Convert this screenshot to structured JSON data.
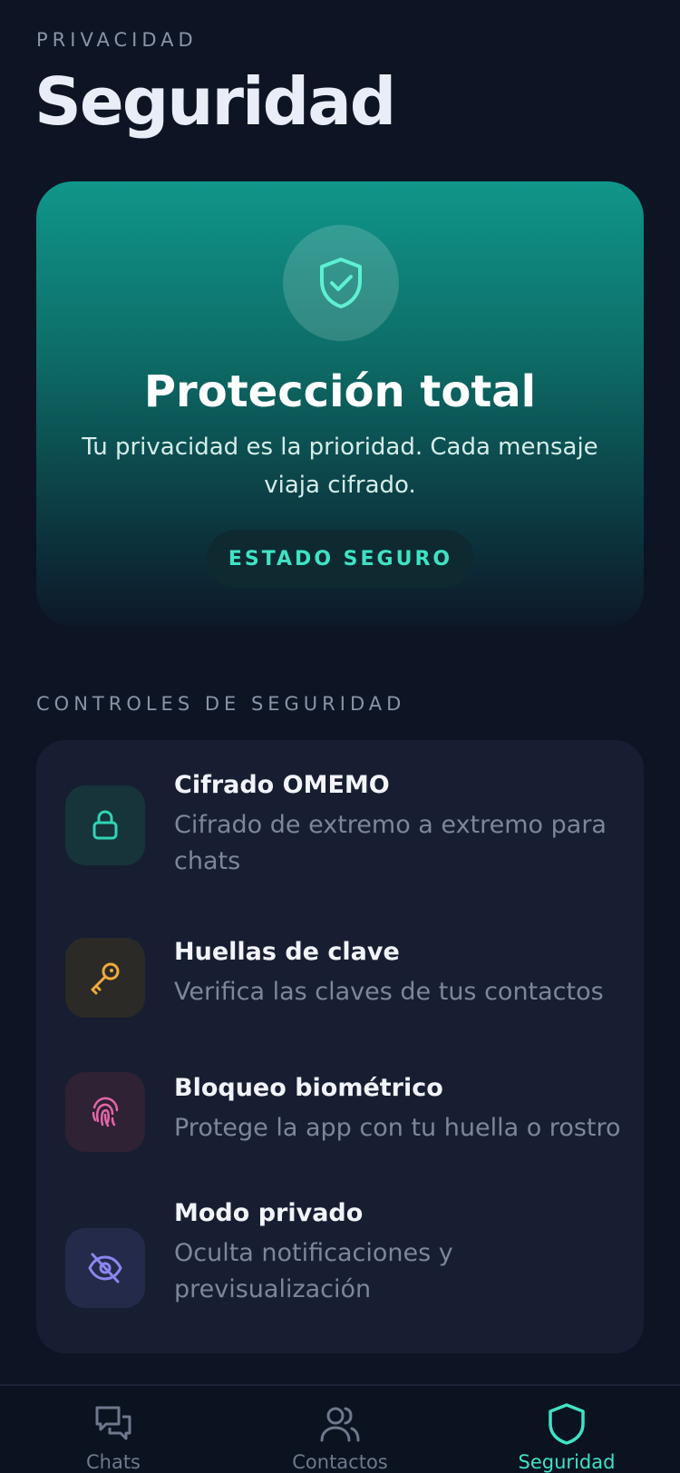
{
  "header": {
    "eyebrow": "PRIVACIDAD",
    "title": "Seguridad"
  },
  "hero": {
    "icon": "shield-check-icon",
    "title": "Protección total",
    "subtitle": "Tu privacidad es la prioridad. Cada mensaje viaja cifrado.",
    "status": "ESTADO SEGURO"
  },
  "section": {
    "label": "CONTROLES DE SEGURIDAD"
  },
  "controls": [
    {
      "icon": "lock-icon",
      "title": "Cifrado OMEMO",
      "description": "Cifrado de extremo a extremo para chats",
      "color": "#2fd4b4"
    },
    {
      "icon": "key-icon",
      "title": "Huellas de clave",
      "description": "Verifica las claves de tus contactos",
      "color": "#f2a93b"
    },
    {
      "icon": "fingerprint-icon",
      "title": "Bloqueo biométrico",
      "description": "Protege la app con tu huella o rostro",
      "color": "#e466a8"
    },
    {
      "icon": "eye-off-icon",
      "title": "Modo privado",
      "description": "Oculta notificaciones y previsualización",
      "color": "#8c86f0"
    }
  ],
  "tabbar": {
    "tabs": [
      {
        "icon": "chat-bubbles-icon",
        "label": "Chats",
        "active": false
      },
      {
        "icon": "users-icon",
        "label": "Contactos",
        "active": false
      },
      {
        "icon": "shield-icon",
        "label": "Seguridad",
        "active": true
      }
    ]
  },
  "colors": {
    "background": "#0d1424",
    "accent": "#3fe2c4",
    "card": "#171e31"
  }
}
